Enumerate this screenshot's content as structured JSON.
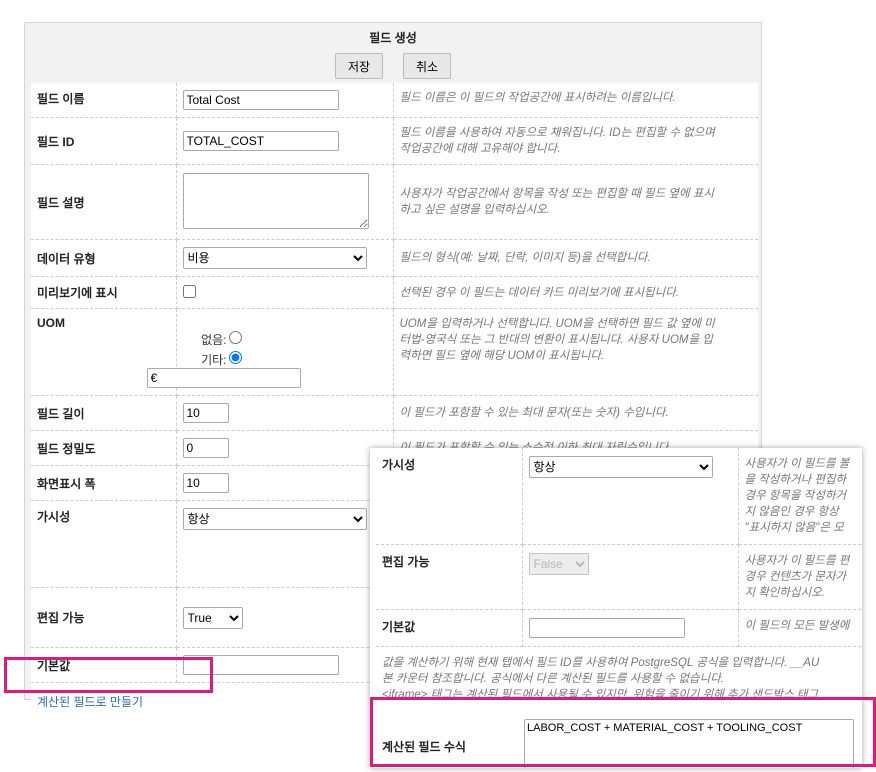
{
  "header": {
    "title": "필드 생성",
    "save": "저장",
    "cancel": "취소"
  },
  "rows": {
    "name": {
      "label": "필드 이름",
      "value": "Total Cost",
      "desc": "필드 이름은 이 필드의 작업공간에 표시하려는 이름입니다."
    },
    "id": {
      "label": "필드 ID",
      "value": "TOTAL_COST",
      "desc1": "필드 이름을 사용하여 자동으로 채워집니다. ID는 편집할 수 없으며",
      "desc2": "작업공간에 대해 고유해야 합니다."
    },
    "description": {
      "label": "필드 설명",
      "value": "",
      "desc1": "사용자가 작업공간에서 항목을 작성 또는 편집할 때 필드 옆에 표시",
      "desc2": "하고 싶은 설명을 입력하십시오."
    },
    "type": {
      "label": "데이터 유형",
      "value": "비용",
      "desc": "필드의 형식(예: 날짜, 단락, 이미지 등)을 선택합니다."
    },
    "preview": {
      "label": "미리보기에 표시",
      "checked": false,
      "desc": "선택된 경우 이 필드는 데이터 카드 미리보기에 표시됩니다."
    },
    "uom": {
      "label": "UOM",
      "none_label": "없음:",
      "other_label": "기타:",
      "other_value": "€",
      "desc1": "UOM을 입력하거나 선택합니다. UOM을 선택하면 필드 값 옆에 미",
      "desc2": "터법-영국식 또는 그 반대의 변환이 표시됩니다. 사용자 UOM을 입",
      "desc3": "력하면 필드 옆에 해당 UOM이 표시됩니다."
    },
    "length": {
      "label": "필드 길이",
      "value": "10",
      "desc": "이 필드가 포함할 수 있는 최대 문자(또는 숫자) 수입니다."
    },
    "precision": {
      "label": "필드 정밀도",
      "value": "0",
      "desc": "이 필드가 포함할 수 있는 소수점 이하 최대 자릿수입니다."
    },
    "width": {
      "label": "화면표시 폭",
      "value": "10"
    },
    "visibility": {
      "label": "가시성",
      "value": "항상"
    },
    "editable": {
      "label": "편집 가능",
      "value": "True"
    },
    "default": {
      "label": "기본값",
      "value": ""
    }
  },
  "calc_link": "계산된 필드로 만들기",
  "overlay": {
    "visibility": {
      "label": "가시성",
      "value": "항상",
      "desc1": "사용자가 이 필드를 볼",
      "desc2": "을 작성하거나 편집하",
      "desc3": "경우 항목을 작성하거",
      "desc4": "지 않음인 경우 항상 ",
      "desc5": "\"표시하지 않음\"은 모"
    },
    "editable": {
      "label": "편집 가능",
      "value": "False",
      "desc1": "사용자가 이 필드를 편",
      "desc2": "경우 컨텐츠가 문자가",
      "desc3": "지 확인하십시오."
    },
    "default": {
      "label": "기본값",
      "value": "",
      "desc": "이 필드의 모든 발생에"
    },
    "help1": "값을 계산하기 위해 현재 탭에서 필드 ID를 사용하여 PostgreSQL 공식을 입력합니다. __AU",
    "help2": "본 카운터 참조합니다. 공식에서 다른 계산된 필드를 사용할 수 없습니다.",
    "help3": "<iframe> 태그는 계산된 필드에서 사용될 수 있지만, 위험을 줄이기 위해 추가 샌드박스 태그",
    "formula_label": "계산된 필드 수식",
    "formula_value": "LABOR_COST + MATERIAL_COST + TOOLING_COST"
  },
  "colors": {
    "highlight": "#e0197d",
    "link": "#2a6ebb"
  }
}
